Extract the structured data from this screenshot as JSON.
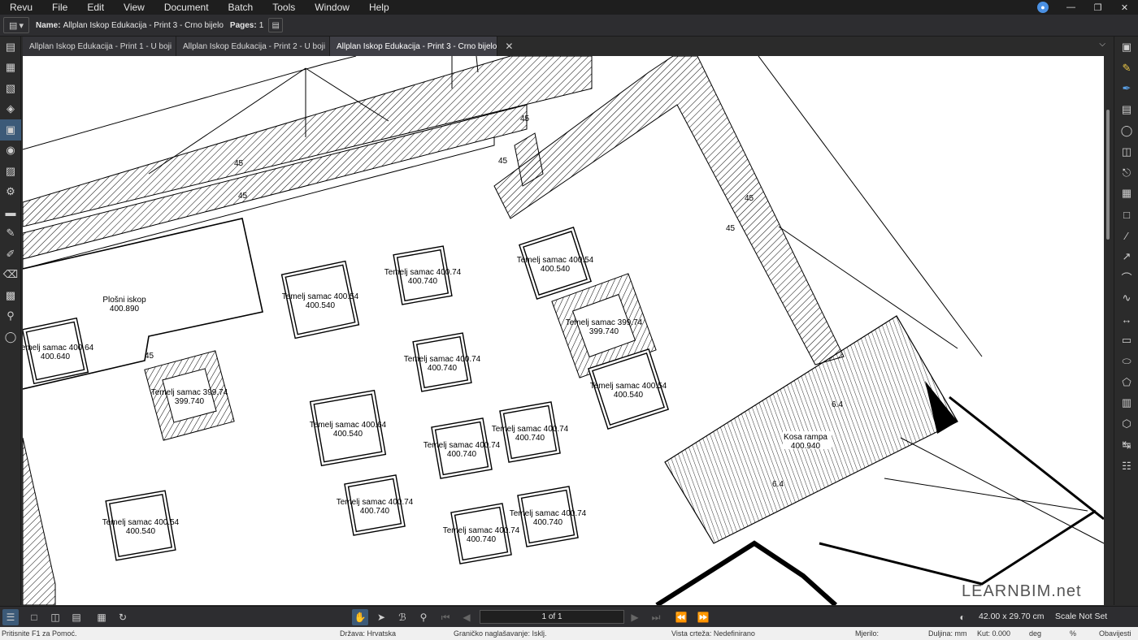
{
  "menubar": {
    "items": [
      "Revu",
      "File",
      "Edit",
      "View",
      "Document",
      "Batch",
      "Tools",
      "Window",
      "Help"
    ]
  },
  "propbar": {
    "name_label": "Name:",
    "name_value": "Allplan Iskop Edukacija - Print 3 - Crno bijelo",
    "pages_label": "Pages:",
    "pages_value": "1"
  },
  "tabs": [
    {
      "label": "Allplan Iskop Edukacija - Print 1 - U boji",
      "active": false
    },
    {
      "label": "Allplan Iskop Edukacija - Print 2 - U boji",
      "active": false
    },
    {
      "label": "Allplan Iskop Edukacija - Print 3 - Crno bijelo",
      "active": true
    }
  ],
  "drawing": {
    "plosni_iskop": {
      "name": "Plošni iskop",
      "elev": "400.890"
    },
    "kosa_rampa": {
      "name": "Kosa rampa",
      "elev": "400.940"
    },
    "slope_marks": [
      "45",
      "45",
      "45",
      "45",
      "45",
      "45",
      "45",
      "6.4",
      "6.4"
    ],
    "foundations": [
      {
        "name": "Temelj samac 400.64",
        "elev": "400.640"
      },
      {
        "name": "Temelj samac 399.74",
        "elev": "399.740"
      },
      {
        "name": "Temelj samac 400.54",
        "elev": "400.540"
      },
      {
        "name": "Temelj samac 400.74",
        "elev": "400.740"
      },
      {
        "name": "Temelj samac 400.54",
        "elev": "400.540"
      },
      {
        "name": "Temelj samac 399.74",
        "elev": "399.740"
      },
      {
        "name": "Temelj samac 400.74",
        "elev": "400.740"
      },
      {
        "name": "Temelj samac 400.64",
        "elev": "400.540"
      },
      {
        "name": "Temelj samac 400.54",
        "elev": "400.540"
      },
      {
        "name": "Temelj samac 400.74",
        "elev": "400.740"
      },
      {
        "name": "Temelj samac 400.74",
        "elev": "400.740"
      },
      {
        "name": "Temelj samac 400.54",
        "elev": "400.540"
      },
      {
        "name": "Temelj samac 400.74",
        "elev": "400.740"
      },
      {
        "name": "Temelj samac 400.74",
        "elev": "400.740"
      },
      {
        "name": "Temelj samac 400.74",
        "elev": "400.740"
      }
    ]
  },
  "bottombar": {
    "page_display": "1 of 1",
    "dimensions": "42.00 x 29.70 cm",
    "scale": "Scale Not Set"
  },
  "watermark": "LEARNBIM.net",
  "statusbar": {
    "help": "Pritisnite F1 za Pomoć.",
    "country": "Država:  Hrvatska",
    "limit": "Graničko naglašavanje:  Isklj.",
    "view": "Vista crteža:  Nedefinirano",
    "measure": "Mjerilo:",
    "length": "Duljina:  mm",
    "angle": "Kut:  0.000",
    "deg": "deg",
    "pct": "%",
    "notices": "Obavijesti"
  }
}
